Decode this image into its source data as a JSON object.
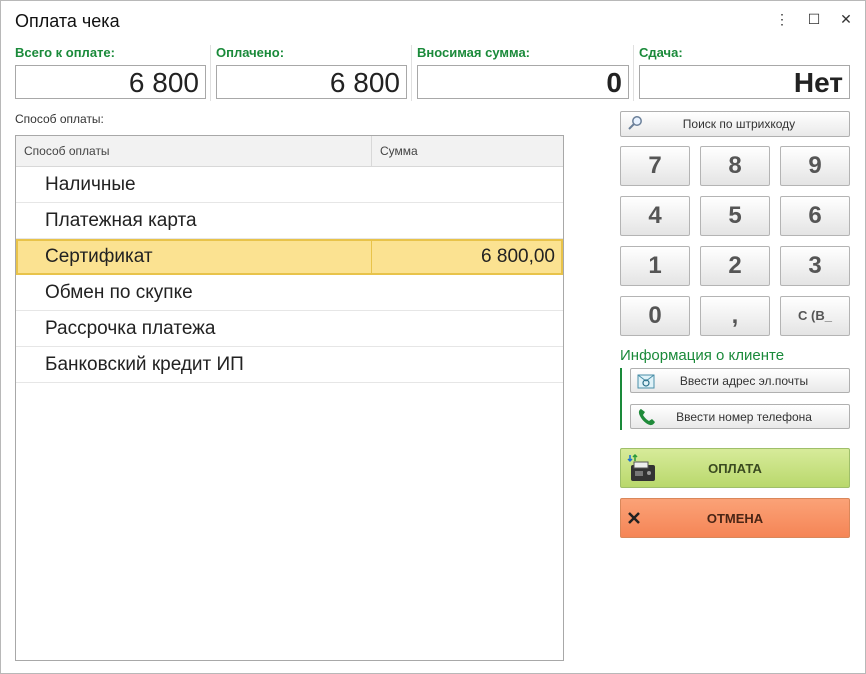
{
  "window": {
    "title": "Оплата чека"
  },
  "totals": {
    "total_label": "Всего к оплате:",
    "total_value": "6 800",
    "paid_label": "Оплачено:",
    "paid_value": "6 800",
    "deposit_label": "Вносимая сумма:",
    "deposit_value": "0",
    "change_label": "Сдача:",
    "change_value": "Нет"
  },
  "payment": {
    "section_label": "Способ оплаты:",
    "columns": [
      "Способ оплаты",
      "Сумма"
    ],
    "rows": [
      {
        "method": "Наличные",
        "amount": ""
      },
      {
        "method": "Платежная карта",
        "amount": ""
      },
      {
        "method": "Сертификат",
        "amount": "6 800,00"
      },
      {
        "method": "Обмен по скупке",
        "amount": ""
      },
      {
        "method": "Рассрочка платежа",
        "amount": ""
      },
      {
        "method": "Банковский кредит ИП",
        "amount": ""
      }
    ]
  },
  "barcode": {
    "label": "Поиск по штрихкоду",
    "icon": "magnifier-icon"
  },
  "keypad": [
    "7",
    "8",
    "9",
    "4",
    "5",
    "6",
    "1",
    "2",
    "3",
    "0",
    ",",
    "С (В_"
  ],
  "client": {
    "title": "Информация о клиенте",
    "email_label": "Ввести адрес эл.почты",
    "phone_label": "Ввести номер телефона"
  },
  "actions": {
    "pay_label": "ОПЛАТА",
    "cancel_label": "ОТМЕНА"
  },
  "colors": {
    "accent_green": "#1a8a3a",
    "selected_row": "#fbe291",
    "pay": "#c8e27f",
    "cancel": "#f8935f"
  }
}
